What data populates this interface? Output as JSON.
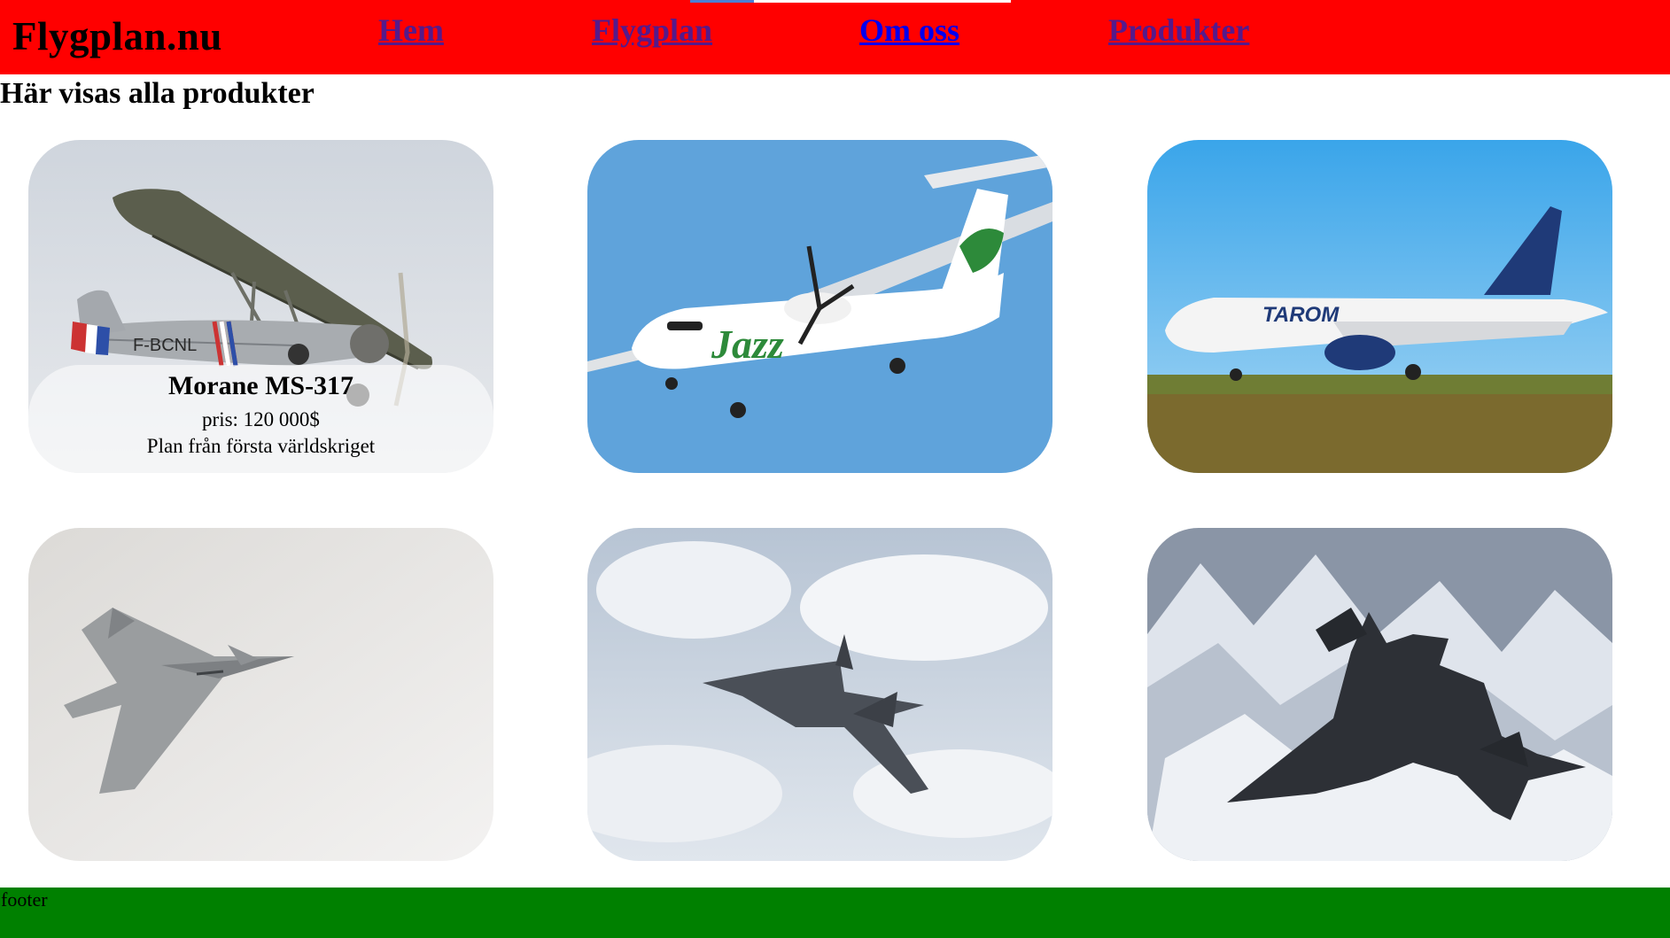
{
  "site": {
    "logo": "Flygplan.nu"
  },
  "nav": {
    "items": [
      "Hem",
      "Flygplan",
      "Om oss",
      "Produkter"
    ]
  },
  "page": {
    "heading": "Här visas alla produkter"
  },
  "products": [
    {
      "name": "Morane MS-317",
      "price": "pris: 120 000$",
      "description": "Plan från första världskriget"
    }
  ],
  "footer": {
    "text": "footer"
  },
  "colors": {
    "header": "#ff0000",
    "footer": "#008000",
    "link": "#551a8b",
    "link_unvisited": "#0000ee"
  },
  "icons": [
    "vintage-plane-photo",
    "turboprop-plane-photo",
    "airliner-photo",
    "fighter-jet-photo",
    "stealth-jet-photo",
    "sr71-photo"
  ]
}
